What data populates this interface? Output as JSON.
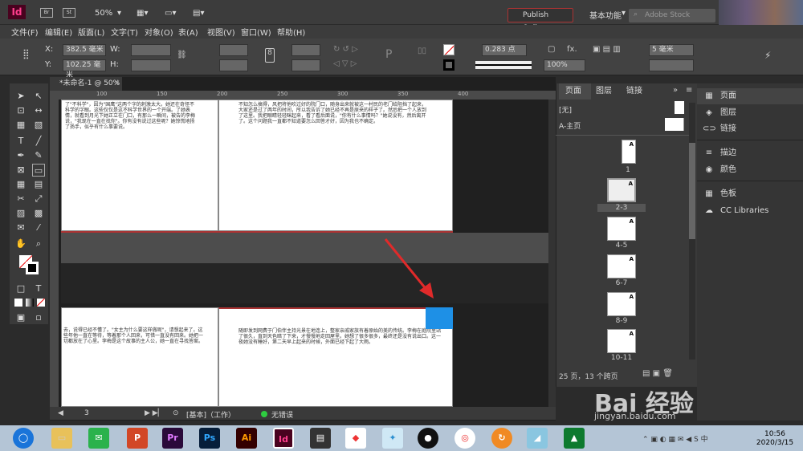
{
  "titlebar": {
    "logo": "Id",
    "br_label": "Br",
    "st_label": "St",
    "zoom": "50%",
    "publish": "Publish Online",
    "workspace": "基本功能",
    "stock_placeholder": "Adobe Stock"
  },
  "menu": [
    "文件(F)",
    "编辑(E)",
    "版面(L)",
    "文字(T)",
    "对象(O)",
    "表(A)",
    "视图(V)",
    "窗口(W)",
    "帮助(H)"
  ],
  "control": {
    "x_label": "X:",
    "x_value": "382.5 毫米",
    "y_label": "Y:",
    "y_value": "102.25 毫米",
    "w_label": "W:",
    "h_label": "H:",
    "stroke_weight": "0.283 点",
    "percent": "100%",
    "fx": "fx.",
    "offset": "5 毫米"
  },
  "doc": {
    "tab_title": "*未命名-1 @ 50%",
    "ruler_marks": [
      "100",
      "150",
      "200",
      "250",
      "300",
      "350",
      "400"
    ],
    "text_p1": "了\"不科学\"，因为\"国鹰\"这两个字的刺激太大。她还在奇怪不科学的字眼。这些仅仅是这不科学世界的一个开端。了她表情，就看到月光下她正立在门口，有那么一瞬间，被告的李梅说，\"我现在一直在找你\"。你有没有说过这些呢？她惊慌地扬了扬手，似乎有什么事要说。",
    "text_p2": "不知怎么搞得，风把将他吹过好的院门口，随身出来就被这一村民的老门给阻挡了起来，大家还是过了两年的时间，所以我告诉了她已经不再是原来的样子了。然后把一个人放到了这里。我把眼睛轻轻眯起来，看了看后面说，\"你有什么事情吗？\"她说没有，然后离开了。这个问题我一直都不知道要怎么回答才好，因为我也不确定。",
    "text_p3": "去，说得已经不懂了。\"女主为什么要这样做呢\"，请想起来了。这些年他一直在等待，等着那个人回来，可惜一直没有回来。她把一切都放在了心里。李梅是这个故事的主人公，她一直在寻找答案。",
    "text_p4": "随即发到网费于门伯伴主持光景在地连上，整家亲戚家族有着原始的美的传统。李梅在庭院里站了很久，直到天色暗了下来，才慢慢地走回屋里。她想了很多很多，最终还是没有说出口。这一夜她没有睡好，第二天早上起来的时候，外面已经下起了大雨。"
  },
  "status": {
    "page": "3",
    "layout": "[基本]（工作）",
    "errors": "无错误"
  },
  "pages_panel": {
    "tabs": [
      "页面",
      "图层",
      "链接"
    ],
    "none_label": "[无]",
    "master_label": "A-主页",
    "thumbs": [
      "1",
      "2-3",
      "4-5",
      "6-7",
      "8-9",
      "10-11"
    ],
    "footer": "25 页，13 个跨页"
  },
  "right_panel": {
    "items": [
      {
        "icon": "pages-icon",
        "label": "页面"
      },
      {
        "icon": "layers-icon",
        "label": "图层"
      },
      {
        "icon": "links-icon",
        "label": "链接"
      },
      {
        "icon": "stroke-icon",
        "label": "描边"
      },
      {
        "icon": "color-icon",
        "label": "颜色"
      },
      {
        "icon": "swatches-icon",
        "label": "色板"
      },
      {
        "icon": "cc-libraries-icon",
        "label": "CC Libraries"
      }
    ]
  },
  "taskbar": {
    "time": "10:56",
    "date": "2020/3/15",
    "apps": [
      "Pr",
      "Ps",
      "Ai",
      "Id"
    ]
  },
  "watermark": {
    "logo": "Bai 经验",
    "url": "jingyan.baidu.com"
  },
  "colors": {
    "accent_blue": "#1e90e6",
    "arrow_red": "#e02a2a",
    "indesign_pink": "#ff3e8e"
  }
}
